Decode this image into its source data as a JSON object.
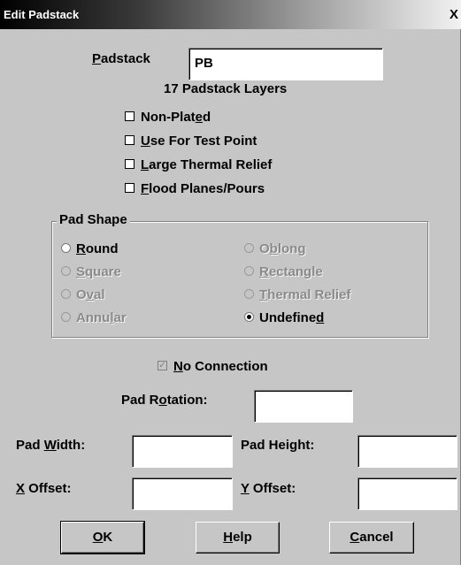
{
  "window": {
    "title": "Edit Padstack",
    "close_glyph": "X"
  },
  "padstack": {
    "label_first": "P",
    "label_rest": "adstack",
    "value": "PB",
    "layers_text": "17 Padstack Layers"
  },
  "checkboxes": [
    {
      "pre": "Non-Plat",
      "key": "e",
      "post": "d",
      "checked": false
    },
    {
      "pre": "",
      "key": "U",
      "post": "se For Test Point",
      "checked": false
    },
    {
      "pre": "",
      "key": "L",
      "post": "arge Thermal Relief",
      "checked": false
    },
    {
      "pre": "",
      "key": "F",
      "post": "lood Planes/Pours",
      "checked": false
    }
  ],
  "pad_shape": {
    "label": "Pad Shape",
    "options": [
      {
        "pre": "",
        "key": "R",
        "post": "ound",
        "enabled": true,
        "selected": false
      },
      {
        "pre": "O",
        "key": "b",
        "post": "long",
        "enabled": false,
        "selected": false
      },
      {
        "pre": "",
        "key": "S",
        "post": "quare",
        "enabled": false,
        "selected": false
      },
      {
        "pre": "",
        "key": "R",
        "post": "ectangle",
        "enabled": false,
        "selected": false
      },
      {
        "pre": "O",
        "key": "v",
        "post": "al",
        "enabled": false,
        "selected": false
      },
      {
        "pre": "",
        "key": "T",
        "post": "hermal Relief",
        "enabled": false,
        "selected": false
      },
      {
        "pre": "Annu",
        "key": "l",
        "post": "ar",
        "enabled": false,
        "selected": false
      },
      {
        "pre": "Undefine",
        "key": "d",
        "post": "",
        "enabled": true,
        "selected": true
      }
    ]
  },
  "no_connection": {
    "key": "N",
    "post": "o Connection",
    "checked": true,
    "mark": "✓"
  },
  "rotation": {
    "pre": "Pad R",
    "key": "o",
    "post": "tation:",
    "value": ""
  },
  "width": {
    "pre": "Pad ",
    "key": "W",
    "post": "idth:",
    "value": ""
  },
  "height": {
    "pre": "Pad Hei",
    "key": "g",
    "post": "ht:",
    "value": ""
  },
  "x_offset": {
    "pre": "",
    "key": "X",
    "post": " Offset:",
    "value": ""
  },
  "y_offset": {
    "pre": "",
    "key": "Y",
    "post": " Offset:",
    "value": ""
  },
  "buttons": {
    "ok": {
      "key": "O",
      "post": "K"
    },
    "help": {
      "key": "H",
      "post": "elp"
    },
    "cancel": {
      "key": "C",
      "post": "ancel"
    }
  }
}
